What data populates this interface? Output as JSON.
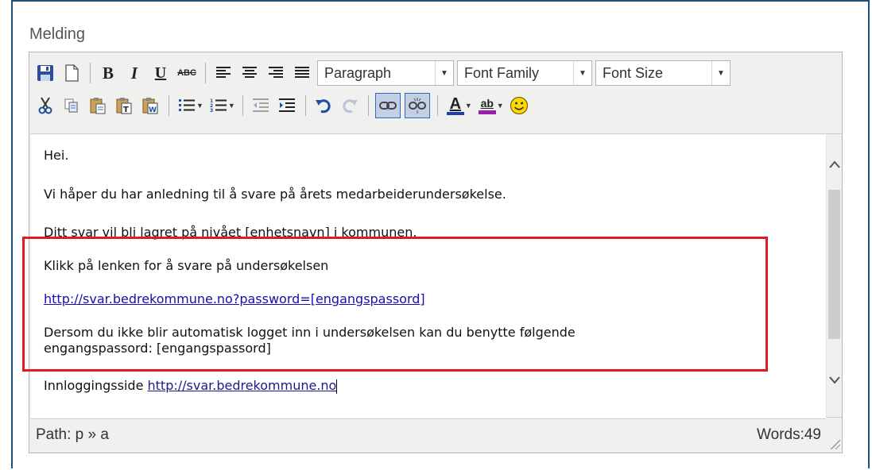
{
  "field": {
    "label": "Melding"
  },
  "toolbar": {
    "bold": "B",
    "italic": "I",
    "underline": "U",
    "strike": "ABC",
    "block_format": "Paragraph",
    "font_family": "Font Family",
    "font_size": "Font Size",
    "forecolor_letter": "A",
    "backcolor_letter": "ab",
    "icons": [
      "save-icon",
      "new-document-icon",
      "bold-icon",
      "italic-icon",
      "underline-icon",
      "strikethrough-icon",
      "align-left-icon",
      "align-center-icon",
      "align-right-icon",
      "align-justify-icon",
      "cut-icon",
      "copy-icon",
      "paste-icon",
      "paste-text-icon",
      "paste-word-icon",
      "bullet-list-icon",
      "numbered-list-icon",
      "outdent-icon",
      "indent-icon",
      "undo-icon",
      "redo-icon",
      "link-icon",
      "unlink-icon",
      "text-color-icon",
      "highlight-color-icon",
      "emoticon-icon"
    ]
  },
  "content": {
    "line1": "Hei.",
    "line2": "Vi håper du har anledning til å svare på årets medarbeiderundersøkelse.",
    "line3": "Ditt svar vil bli lagret på nivået [enhetsnavn] i kommunen.",
    "line4": "Klikk på lenken for å svare på undersøkelsen",
    "link1": "http://svar.bedrekommune.no?password=[engangspassord]",
    "line6a": "Dersom du ikke blir automatisk logget inn i undersøkelsen kan du benytte følgende",
    "line6b": "engangspassord: [engangspassord]",
    "line7_prefix": "Innloggingsside ",
    "link2": "http://svar.bedrekommune.no"
  },
  "statusbar": {
    "path": "Path: p » a",
    "words": "Words:49"
  },
  "colors": {
    "highlight_border": "#e01b24",
    "frame_border": "#1f4e79",
    "link": "#1a0dab"
  }
}
